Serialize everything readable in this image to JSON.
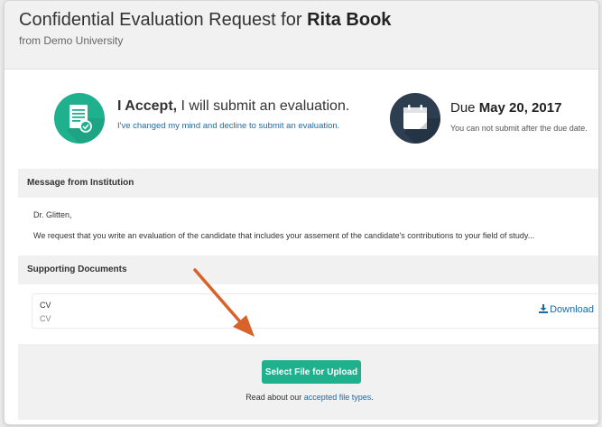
{
  "header": {
    "title_prefix": "Confidential Evaluation Request for",
    "title_name": "Rita Book",
    "subtitle": "from Demo University"
  },
  "status": {
    "accept_bold": "I Accept,",
    "accept_rest": " I will submit an evaluation.",
    "decline_link": "I've changed my mind and decline to submit an evaluation.",
    "due_prefix": "Due ",
    "due_date": "May 20, 2017",
    "due_note": "You can not submit after the due date."
  },
  "message": {
    "header": "Message from Institution",
    "salutation": "Dr. Glitten,",
    "body": "We request that you write an evaluation of the candidate that includes your assement of the candidate's contributions to your field of study..."
  },
  "documents": {
    "header": "Supporting Documents",
    "items": [
      {
        "name": "CV",
        "type": "CV",
        "action": "Download"
      }
    ]
  },
  "upload": {
    "button": "Select File for Upload",
    "note_prefix": "Read about our ",
    "note_link": "accepted file types",
    "note_suffix": "."
  },
  "colors": {
    "accent": "#1fb08e",
    "link": "#1f6aa5",
    "navy": "#2c3e50",
    "arrow": "#d9622b"
  },
  "icons": [
    "document-check-icon",
    "calendar-icon",
    "download-icon",
    "annotation-arrow"
  ]
}
